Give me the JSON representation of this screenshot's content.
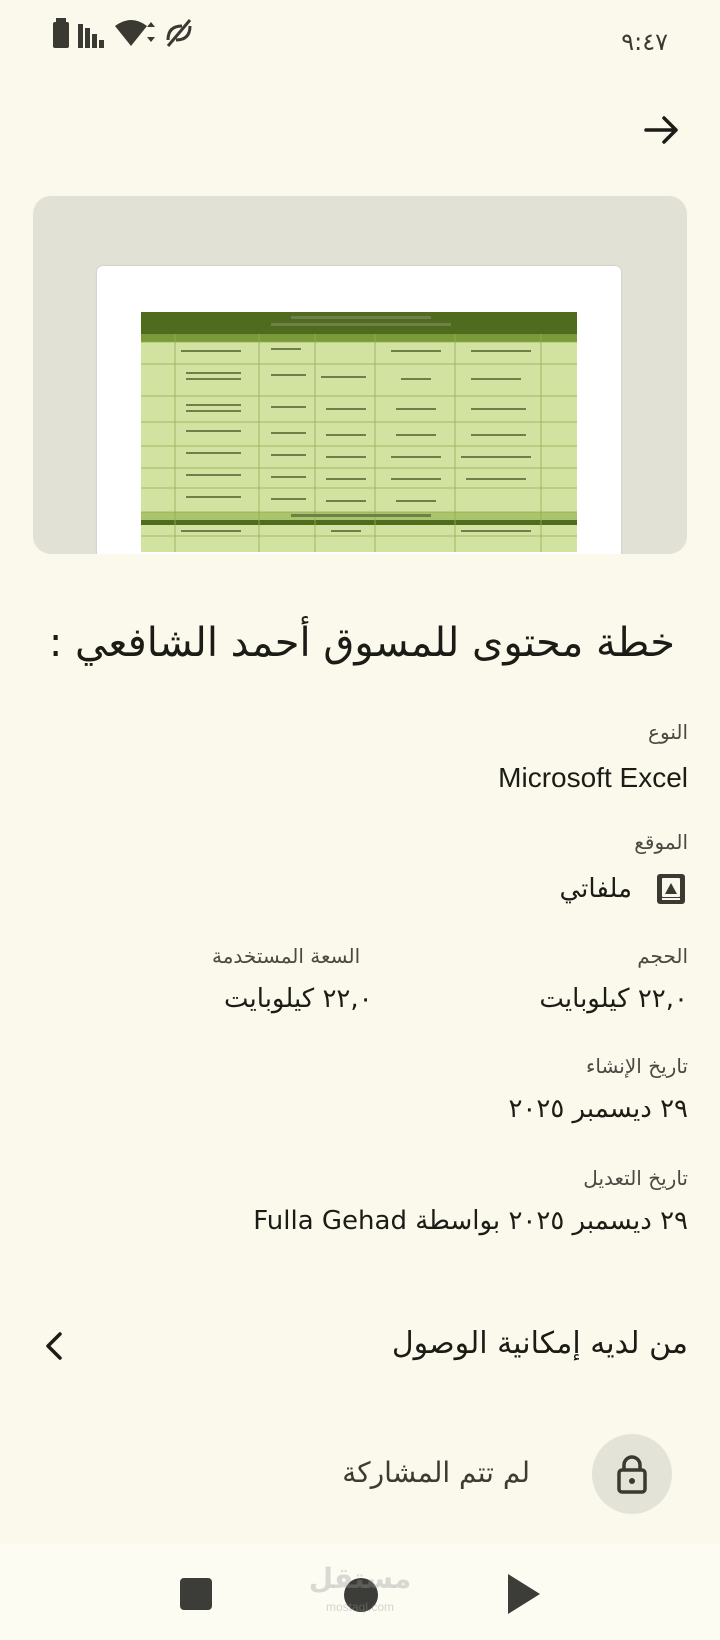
{
  "status_bar": {
    "time": "٩:٤٧",
    "icons": [
      "battery-icon",
      "signal-icon",
      "wifi-icon",
      "no-sync-icon"
    ]
  },
  "header": {
    "back_icon": "arrow-forward-icon"
  },
  "file": {
    "title": "خطة محتوى للمسوق أحمد الشافعي :",
    "type_label": "النوع",
    "type_value": "Microsoft Excel",
    "location_label": "الموقع",
    "location_value": "ملفاتي",
    "size_label": "الحجم",
    "size_value": "٢٢,٠ كيلوبايت",
    "used_label": "السعة المستخدمة",
    "used_value": "٢٢,٠ كيلوبايت",
    "created_label": "تاريخ الإنشاء",
    "created_value": "٢٩ ديسمبر ٢٠٢٥",
    "modified_label": "تاريخ التعديل",
    "modified_value": "٢٩ ديسمبر ٢٠٢٥ بواسطة Fulla Gehad"
  },
  "access": {
    "label": "من لديه إمكانية الوصول"
  },
  "sharing": {
    "label": "لم تتم المشاركة"
  },
  "watermark": {
    "text": "مستقل",
    "sub": "mostaql.com"
  },
  "colors": {
    "background": "#fbf9ec",
    "preview_bg": "#e1e1d6",
    "sheet_header": "#4f6b1e",
    "sheet_cell": "#c9dc8f"
  }
}
